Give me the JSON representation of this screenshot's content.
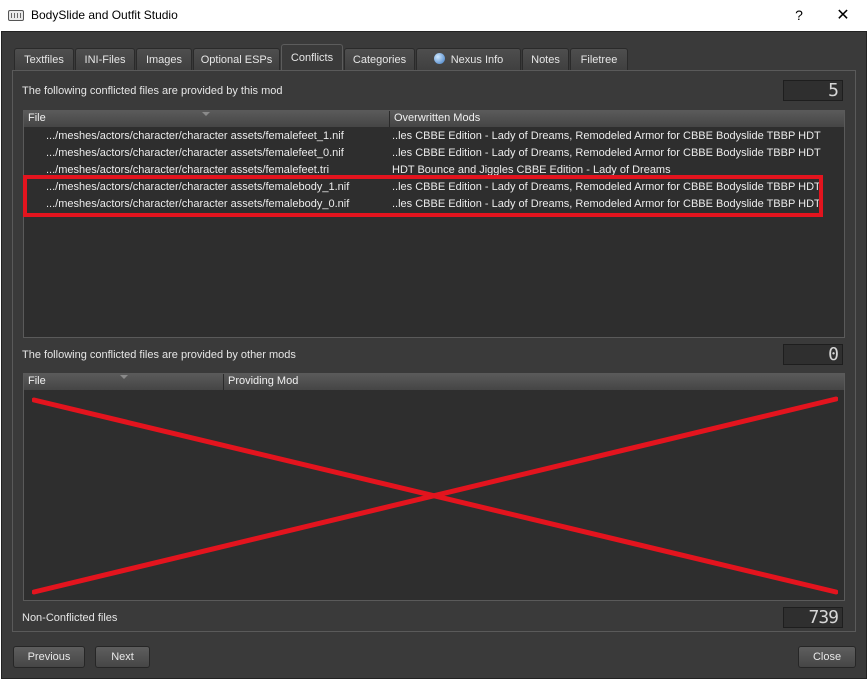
{
  "window": {
    "title": "BodySlide and Outfit Studio",
    "help_glyph": "?",
    "close_glyph": "✕"
  },
  "tabs": [
    {
      "label": "Textfiles"
    },
    {
      "label": "INI-Files"
    },
    {
      "label": "Images"
    },
    {
      "label": "Optional ESPs"
    },
    {
      "label": "Conflicts",
      "active": true
    },
    {
      "label": "Categories"
    },
    {
      "label": "Nexus Info",
      "icon": "globe-icon"
    },
    {
      "label": "Notes"
    },
    {
      "label": "Filetree"
    }
  ],
  "provided_by_this_mod": {
    "label": "The following conflicted files are provided by this mod",
    "count": "5",
    "columns": [
      "File",
      "Overwritten Mods"
    ],
    "rows": [
      {
        "file": ".../meshes/actors/character/character assets/femalefeet_1.nif",
        "mods": "..les CBBE Edition - Lady of Dreams, Remodeled Armor for CBBE Bodyslide TBBP HDT"
      },
      {
        "file": ".../meshes/actors/character/character assets/femalefeet_0.nif",
        "mods": "..les CBBE Edition - Lady of Dreams, Remodeled Armor for CBBE Bodyslide TBBP HDT"
      },
      {
        "file": ".../meshes/actors/character/character assets/femalefeet.tri",
        "mods": "HDT Bounce and Jiggles CBBE Edition - Lady of Dreams"
      },
      {
        "file": ".../meshes/actors/character/character assets/femalebody_1.nif",
        "mods": "..les CBBE Edition - Lady of Dreams, Remodeled Armor for CBBE Bodyslide TBBP HDT"
      },
      {
        "file": ".../meshes/actors/character/character assets/femalebody_0.nif",
        "mods": "..les CBBE Edition - Lady of Dreams, Remodeled Armor for CBBE Bodyslide TBBP HDT"
      }
    ]
  },
  "provided_by_other_mods": {
    "label": "The following conflicted files are provided by other mods",
    "count": "0",
    "columns": [
      "File",
      "Providing Mod"
    ]
  },
  "non_conflicted": {
    "label": "Non-Conflicted files",
    "count": "739"
  },
  "buttons": {
    "previous": "Previous",
    "next": "Next",
    "close": "Close"
  },
  "annotation_color": "#e3141e"
}
